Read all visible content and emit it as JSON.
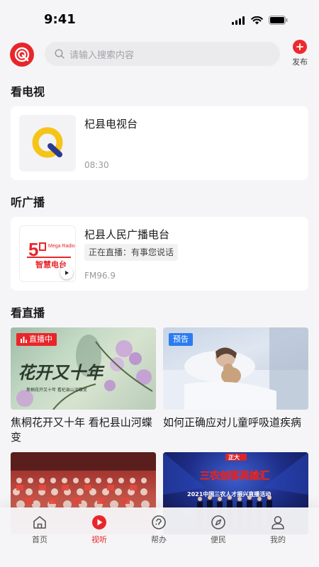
{
  "status_bar": {
    "time": "9:41"
  },
  "header": {
    "search_placeholder": "请输入搜索内容",
    "publish_label": "发布"
  },
  "sections": {
    "tv_title": "看电视",
    "radio_title": "听广播",
    "live_title": "看直播"
  },
  "tv": {
    "name": "杞县电视台",
    "time": "08:30"
  },
  "radio": {
    "name": "杞县人民广播电台",
    "status": "正在直播：有事您说话",
    "frequency": "FM96.9",
    "logo_text_top": "Mega Radio",
    "logo_text_main": "智慧电台"
  },
  "live": [
    {
      "title": "焦桐花开又十年 看杞县山河蝶变",
      "badge": "直播中",
      "art_text": "花开又十年",
      "art_sub": "焦桐花开又十年 看杞县山河蝶变"
    },
    {
      "title": "如何正确应对儿童呼吸道疾病",
      "badge": "预告"
    },
    {
      "title": ""
    },
    {
      "title": "",
      "art_text": "三农创客英雄汇",
      "art_brand": "正大",
      "art_sub": "2021中国三农人才振兴直播活动"
    }
  ],
  "tabbar": [
    {
      "label": "首页",
      "icon": "home-icon"
    },
    {
      "label": "视听",
      "icon": "play-icon"
    },
    {
      "label": "帮办",
      "icon": "help-icon"
    },
    {
      "label": "便民",
      "icon": "compass-icon"
    },
    {
      "label": "我的",
      "icon": "user-icon"
    }
  ],
  "colors": {
    "accent": "#e8262a",
    "preview": "#2b7cf0",
    "background": "#f5f5f7"
  }
}
